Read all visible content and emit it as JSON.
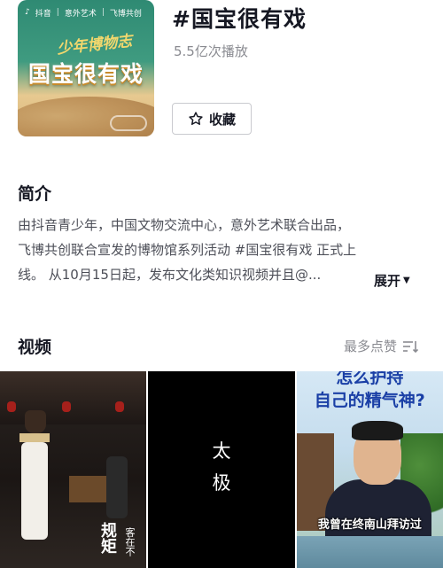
{
  "header": {
    "cover": {
      "top_brand": "抖音",
      "top_partner": "意外艺术",
      "top_partner2": "飞博共创",
      "brush_text": "少年博物志",
      "title": "国宝很有戏"
    },
    "title": "#国宝很有戏",
    "plays": "5.5亿次播放",
    "collect_label": "收藏"
  },
  "intro": {
    "heading": "简介",
    "lines": [
      "由抖音青少年，中国文物交流中心，意外艺术联合出品，",
      "飞博共创联合宣发的博物馆系列活动 #国宝很有戏 正式上",
      "线。 从10月15日起，发布文化类知识视频并且@..."
    ],
    "expand_label": "展开"
  },
  "videos": {
    "heading": "视频",
    "sort_label": "最多点赞",
    "tiles": [
      {
        "text_big": "规矩",
        "text_small": "客在不"
      },
      {
        "text": "太\n极",
        "line1": "太",
        "line2": "极"
      },
      {
        "top_line1": "怎么护持",
        "top_line2": "自己的精气神?",
        "caption": "我曾在终南山拜访过"
      }
    ]
  },
  "colors": {
    "text_primary": "#161823",
    "text_secondary": "#8a8b91",
    "body_text": "#4d4f58"
  }
}
